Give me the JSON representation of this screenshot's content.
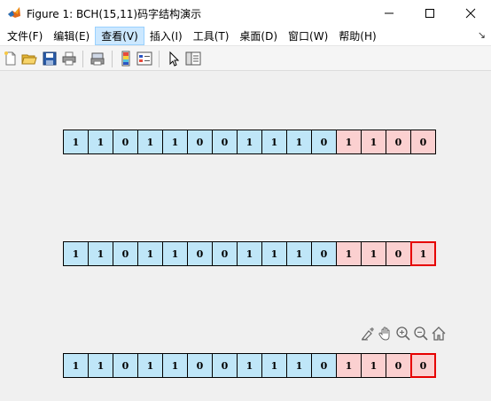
{
  "window": {
    "title": "Figure 1: BCH(15,11)码字结构演示",
    "icon": "matlab-icon"
  },
  "menu": {
    "items": [
      "文件(F)",
      "编辑(E)",
      "查看(V)",
      "插入(I)",
      "工具(T)",
      "桌面(D)",
      "窗口(W)",
      "帮助(H)"
    ],
    "active": "查看(V)"
  },
  "toolbar": {
    "icons": [
      "new-figure-icon",
      "open-file-icon",
      "save-icon",
      "print-icon",
      "print-preview-icon",
      "colorbar-icon",
      "legend-icon",
      "pointer-icon",
      "property-editor-icon"
    ]
  },
  "rows": [
    {
      "bits": [
        "1",
        "1",
        "0",
        "1",
        "1",
        "0",
        "0",
        "1",
        "1",
        "1",
        "0",
        "1",
        "1",
        "0",
        "0"
      ],
      "error_index": null
    },
    {
      "bits": [
        "1",
        "1",
        "0",
        "1",
        "1",
        "0",
        "0",
        "1",
        "1",
        "1",
        "0",
        "1",
        "1",
        "0",
        "1"
      ],
      "error_index": 14
    },
    {
      "bits": [
        "1",
        "1",
        "0",
        "1",
        "1",
        "0",
        "0",
        "1",
        "1",
        "1",
        "0",
        "1",
        "1",
        "0",
        "0"
      ],
      "error_index": 14
    }
  ],
  "info_bits": 11,
  "colors": {
    "info": "#bfe6f8",
    "parity": "#fbd0d0",
    "error_border": "#e60000"
  },
  "axes_toolbar": {
    "icons": [
      "brush-icon",
      "pan-icon",
      "zoom-in-icon",
      "zoom-out-icon",
      "home-icon"
    ]
  }
}
